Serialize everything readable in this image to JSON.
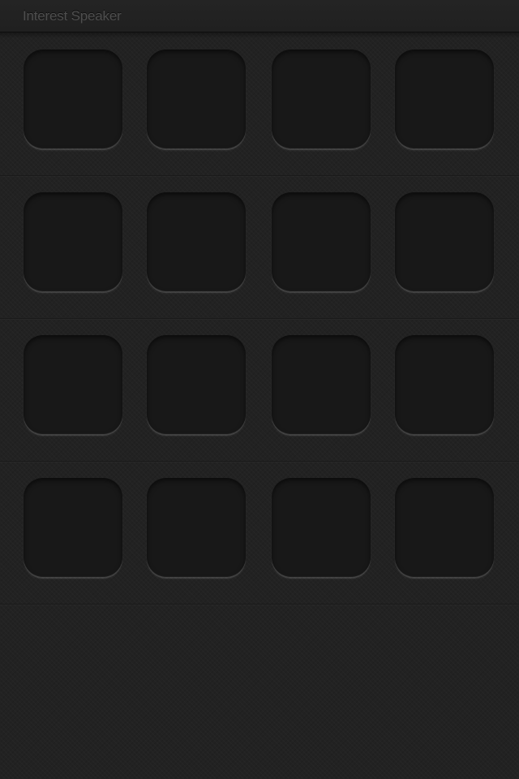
{
  "app": {
    "title": "Interest Speaker"
  },
  "grid": {
    "rows": 4,
    "columns": 4,
    "slots_state": "empty"
  },
  "colors": {
    "background": "#222222",
    "slot": "#181818",
    "title_text": "#4e4e4e"
  }
}
